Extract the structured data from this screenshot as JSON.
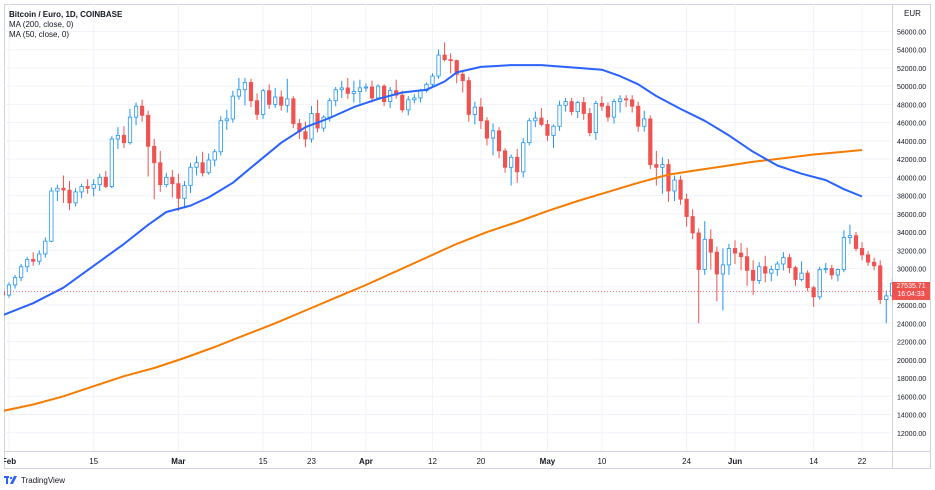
{
  "legend": {
    "title": "Bitcoin / Euro, 1D, COINBASE",
    "ma200": "MA (200, close, 0)",
    "ma50": "MA (50, close, 0)"
  },
  "currency": "EUR",
  "last_price": {
    "value": "27535.71",
    "countdown": "16:04:33",
    "color": "#ef5350"
  },
  "brand": "TradingView",
  "colors": {
    "up": "#2196f3",
    "down": "#ef5350",
    "ma50": "#2962ff",
    "ma200": "#f57c00",
    "grid": "#f0f3fa"
  },
  "chart_data": {
    "type": "candlestick",
    "title": "Bitcoin / Euro, 1D, COINBASE",
    "ylim": [
      10000,
      59000
    ],
    "y_ticks": [
      "12000.00",
      "14000.00",
      "16000.00",
      "18000.00",
      "20000.00",
      "22000.00",
      "24000.00",
      "26000.00",
      "28000.00",
      "30000.00",
      "32000.00",
      "34000.00",
      "36000.00",
      "38000.00",
      "40000.00",
      "42000.00",
      "44000.00",
      "46000.00",
      "48000.00",
      "50000.00",
      "52000.00",
      "54000.00",
      "56000.00"
    ],
    "x_ticks": [
      {
        "label": "Feb",
        "day": 0
      },
      {
        "label": "15",
        "day": 14
      },
      {
        "label": "Mar",
        "day": 28
      },
      {
        "label": "15",
        "day": 42
      },
      {
        "label": "23",
        "day": 50
      },
      {
        "label": "Apr",
        "day": 59
      },
      {
        "label": "12",
        "day": 70
      },
      {
        "label": "20",
        "day": 78
      },
      {
        "label": "May",
        "day": 89
      },
      {
        "label": "10",
        "day": 98
      },
      {
        "label": "24",
        "day": 112
      },
      {
        "label": "Jun",
        "day": 120
      },
      {
        "label": "14",
        "day": 133
      },
      {
        "label": "22",
        "day": 141
      }
    ],
    "first_day_offset": -1,
    "candles": [
      [
        27400,
        28600,
        26300,
        27100
      ],
      [
        27100,
        28500,
        26800,
        28200
      ],
      [
        28200,
        29300,
        27800,
        29000
      ],
      [
        29000,
        30500,
        28600,
        30200
      ],
      [
        30200,
        31300,
        29600,
        31000
      ],
      [
        31000,
        31800,
        30300,
        30800
      ],
      [
        30800,
        32000,
        30400,
        31600
      ],
      [
        31600,
        33400,
        31200,
        33000
      ],
      [
        33000,
        38900,
        32900,
        38500
      ],
      [
        38500,
        39200,
        37400,
        38800
      ],
      [
        38800,
        40200,
        37200,
        38600
      ],
      [
        38600,
        39600,
        36400,
        37200
      ],
      [
        37200,
        38800,
        36800,
        38400
      ],
      [
        38400,
        39300,
        37700,
        39000
      ],
      [
        39000,
        39800,
        38200,
        38800
      ],
      [
        38800,
        39800,
        37900,
        39200
      ],
      [
        39200,
        40400,
        38500,
        40000
      ],
      [
        40000,
        40700,
        38800,
        39000
      ],
      [
        39000,
        44500,
        38800,
        44200
      ],
      [
        44200,
        45500,
        43100,
        44600
      ],
      [
        44600,
        45600,
        43200,
        43800
      ],
      [
        43800,
        47500,
        43600,
        46600
      ],
      [
        46600,
        48200,
        45700,
        47800
      ],
      [
        47800,
        48500,
        46100,
        46800
      ],
      [
        46800,
        47300,
        40100,
        43400
      ],
      [
        43400,
        44200,
        37600,
        41600
      ],
      [
        41600,
        42900,
        38400,
        39200
      ],
      [
        39200,
        40500,
        38900,
        40000
      ],
      [
        40000,
        40800,
        37800,
        39300
      ],
      [
        39300,
        40400,
        36300,
        37700
      ],
      [
        37700,
        39600,
        36600,
        39100
      ],
      [
        39100,
        41600,
        38300,
        41100
      ],
      [
        41100,
        42300,
        40200,
        41600
      ],
      [
        41600,
        42800,
        40100,
        40500
      ],
      [
        40500,
        42600,
        40300,
        41900
      ],
      [
        41900,
        43100,
        41200,
        42800
      ],
      [
        42800,
        46700,
        42400,
        46200
      ],
      [
        46200,
        47400,
        45200,
        46400
      ],
      [
        46400,
        49500,
        46000,
        48900
      ],
      [
        48900,
        50900,
        48500,
        49600
      ],
      [
        49600,
        50900,
        47900,
        50400
      ],
      [
        50400,
        50800,
        47700,
        48400
      ],
      [
        48400,
        49200,
        46300,
        46900
      ],
      [
        46900,
        49700,
        46400,
        49500
      ],
      [
        49500,
        50200,
        47500,
        48000
      ],
      [
        48000,
        49800,
        47600,
        48800
      ],
      [
        48800,
        49500,
        47300,
        47900
      ],
      [
        47900,
        50800,
        47100,
        48600
      ],
      [
        48600,
        48900,
        45400,
        45900
      ],
      [
        45900,
        46400,
        44200,
        45000
      ],
      [
        45000,
        46100,
        43300,
        44200
      ],
      [
        44200,
        47800,
        43800,
        47000
      ],
      [
        47000,
        48500,
        44900,
        45400
      ],
      [
        45400,
        46800,
        45000,
        46600
      ],
      [
        46600,
        48700,
        46100,
        48400
      ],
      [
        48400,
        49900,
        47800,
        49600
      ],
      [
        49600,
        50600,
        48700,
        49800
      ],
      [
        49800,
        50900,
        48600,
        49200
      ],
      [
        49200,
        50600,
        48200,
        49400
      ],
      [
        49400,
        50700,
        48100,
        49800
      ],
      [
        49800,
        50300,
        49400,
        49900
      ],
      [
        49900,
        50600,
        48200,
        48700
      ],
      [
        48700,
        50200,
        48500,
        50000
      ],
      [
        50000,
        50200,
        47800,
        48300
      ],
      [
        48300,
        49900,
        47600,
        49500
      ],
      [
        49500,
        50700,
        48600,
        49000
      ],
      [
        49000,
        49500,
        47100,
        47400
      ],
      [
        47400,
        48900,
        46800,
        48500
      ],
      [
        48500,
        49100,
        48100,
        48700
      ],
      [
        48700,
        49700,
        48200,
        49500
      ],
      [
        49500,
        50400,
        49300,
        50200
      ],
      [
        50200,
        51400,
        49900,
        51100
      ],
      [
        51100,
        54000,
        50800,
        53400
      ],
      [
        53400,
        54800,
        52700,
        52900
      ],
      [
        52900,
        53600,
        51400,
        52800
      ],
      [
        52800,
        52900,
        50300,
        51300
      ],
      [
        51300,
        51600,
        49300,
        50600
      ],
      [
        50600,
        51000,
        46100,
        46900
      ],
      [
        46900,
        48300,
        45800,
        47700
      ],
      [
        47700,
        48700,
        45300,
        46200
      ],
      [
        46200,
        46600,
        43500,
        44300
      ],
      [
        44300,
        45900,
        42400,
        45100
      ],
      [
        45100,
        45500,
        42100,
        42900
      ],
      [
        42900,
        43200,
        40500,
        41100
      ],
      [
        41100,
        42500,
        39100,
        42200
      ],
      [
        42200,
        43100,
        39400,
        40600
      ],
      [
        40600,
        44300,
        40000,
        43800
      ],
      [
        43800,
        46500,
        43500,
        46200
      ],
      [
        46200,
        47200,
        45500,
        46500
      ],
      [
        46500,
        47600,
        45600,
        45800
      ],
      [
        45800,
        46300,
        44000,
        44600
      ],
      [
        44600,
        45800,
        43200,
        45600
      ],
      [
        45600,
        48400,
        45100,
        47900
      ],
      [
        47900,
        48700,
        47200,
        48300
      ],
      [
        48300,
        48700,
        46800,
        47200
      ],
      [
        47200,
        48400,
        46500,
        48200
      ],
      [
        48200,
        48800,
        46300,
        47000
      ],
      [
        47000,
        47600,
        44500,
        44900
      ],
      [
        44900,
        48400,
        44100,
        48100
      ],
      [
        48100,
        48900,
        47300,
        47800
      ],
      [
        47800,
        48200,
        46100,
        46600
      ],
      [
        46600,
        48600,
        45900,
        48300
      ],
      [
        48300,
        49000,
        47100,
        48600
      ],
      [
        48600,
        49000,
        47700,
        48500
      ],
      [
        48500,
        49000,
        47100,
        47800
      ],
      [
        47800,
        48300,
        45000,
        45600
      ],
      [
        45600,
        47300,
        45000,
        46400
      ],
      [
        46400,
        46800,
        40900,
        41400
      ],
      [
        41400,
        42900,
        39100,
        41100
      ],
      [
        41100,
        42200,
        38200,
        41400
      ],
      [
        41400,
        42000,
        37300,
        38500
      ],
      [
        38500,
        40200,
        37400,
        39700
      ],
      [
        39700,
        40200,
        37000,
        37600
      ],
      [
        37600,
        38200,
        34600,
        35700
      ],
      [
        35700,
        36500,
        33200,
        33900
      ],
      [
        33900,
        34400,
        24000,
        29900
      ],
      [
        29900,
        35200,
        29300,
        33200
      ],
      [
        33200,
        34300,
        29900,
        31800
      ],
      [
        31800,
        32400,
        26400,
        29400
      ],
      [
        29400,
        32200,
        25400,
        30400
      ],
      [
        30400,
        32700,
        29300,
        32200
      ],
      [
        32200,
        33100,
        30500,
        31700
      ],
      [
        31700,
        32800,
        29800,
        31300
      ],
      [
        31300,
        32300,
        28100,
        29800
      ],
      [
        29800,
        30900,
        27100,
        28700
      ],
      [
        28700,
        30700,
        28300,
        30200
      ],
      [
        30200,
        31400,
        28500,
        29500
      ],
      [
        29500,
        30300,
        28600,
        29900
      ],
      [
        29900,
        30800,
        29200,
        30500
      ],
      [
        30500,
        31800,
        29800,
        31200
      ],
      [
        31200,
        31600,
        29500,
        30100
      ],
      [
        30100,
        30300,
        28100,
        28800
      ],
      [
        28800,
        30800,
        28600,
        29500
      ],
      [
        29500,
        29800,
        27500,
        27900
      ],
      [
        27900,
        28100,
        25800,
        26900
      ],
      [
        26900,
        30200,
        26600,
        29900
      ],
      [
        29900,
        30600,
        29500,
        30000
      ],
      [
        30000,
        30400,
        28800,
        29300
      ],
      [
        29300,
        30000,
        28600,
        29900
      ],
      [
        29900,
        34200,
        29600,
        33400
      ],
      [
        33400,
        34800,
        32700,
        33600
      ],
      [
        33600,
        34000,
        31900,
        32200
      ],
      [
        32200,
        32900,
        30900,
        31500
      ],
      [
        31500,
        31900,
        30300,
        30700
      ],
      [
        30700,
        31200,
        29800,
        30300
      ],
      [
        30300,
        30900,
        26100,
        26600
      ],
      [
        26600,
        27600,
        24000,
        27000
      ],
      [
        27000,
        28900,
        26800,
        28400
      ],
      [
        28400,
        28800,
        27100,
        27500
      ]
    ],
    "ma50": [
      [
        -1,
        24900
      ],
      [
        4,
        26200
      ],
      [
        9,
        27900
      ],
      [
        14,
        30300
      ],
      [
        19,
        32700
      ],
      [
        23,
        34800
      ],
      [
        26,
        36200
      ],
      [
        30,
        36900
      ],
      [
        33,
        37800
      ],
      [
        37,
        39400
      ],
      [
        41,
        41600
      ],
      [
        45,
        43800
      ],
      [
        49,
        45500
      ],
      [
        53,
        46500
      ],
      [
        57,
        47700
      ],
      [
        61,
        48600
      ],
      [
        65,
        49300
      ],
      [
        69,
        49600
      ],
      [
        72,
        50500
      ],
      [
        74,
        51500
      ],
      [
        78,
        52100
      ],
      [
        83,
        52300
      ],
      [
        88,
        52300
      ],
      [
        94,
        52000
      ],
      [
        98,
        51800
      ],
      [
        101,
        51100
      ],
      [
        104,
        50200
      ],
      [
        107,
        48900
      ],
      [
        111,
        47500
      ],
      [
        115,
        46200
      ],
      [
        119,
        44600
      ],
      [
        123,
        42800
      ],
      [
        127,
        41300
      ],
      [
        131,
        40400
      ],
      [
        135,
        39700
      ],
      [
        138,
        38700
      ],
      [
        141,
        37900
      ]
    ],
    "ma200": [
      [
        -1,
        14400
      ],
      [
        4,
        15100
      ],
      [
        9,
        16000
      ],
      [
        14,
        17100
      ],
      [
        19,
        18200
      ],
      [
        24,
        19100
      ],
      [
        29,
        20200
      ],
      [
        34,
        21400
      ],
      [
        39,
        22700
      ],
      [
        44,
        24000
      ],
      [
        49,
        25400
      ],
      [
        54,
        26800
      ],
      [
        59,
        28200
      ],
      [
        64,
        29700
      ],
      [
        69,
        31200
      ],
      [
        74,
        32700
      ],
      [
        79,
        34000
      ],
      [
        84,
        35100
      ],
      [
        89,
        36300
      ],
      [
        94,
        37400
      ],
      [
        99,
        38400
      ],
      [
        104,
        39400
      ],
      [
        109,
        40300
      ],
      [
        113,
        40700
      ],
      [
        118,
        41200
      ],
      [
        123,
        41700
      ],
      [
        128,
        42100
      ],
      [
        133,
        42500
      ],
      [
        138,
        42800
      ],
      [
        141,
        43000
      ]
    ]
  }
}
